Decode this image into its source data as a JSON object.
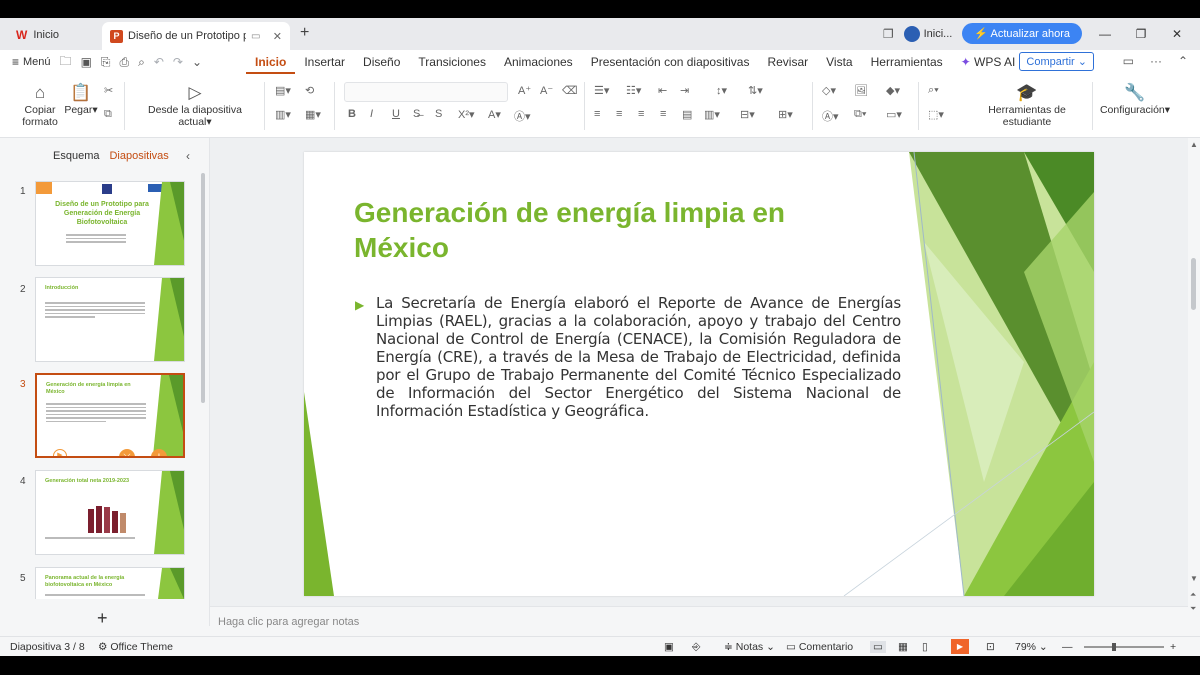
{
  "window": {
    "home_tab": "Inicio",
    "doc_tab": "Diseño de un Prototipo para G",
    "user": "Inici...",
    "upgrade": "Actualizar ahora"
  },
  "menu": {
    "menu_label": "Menú",
    "tabs": [
      "Inicio",
      "Insertar",
      "Diseño",
      "Transiciones",
      "Animaciones",
      "Presentación con diapositivas",
      "Revisar",
      "Vista",
      "Herramientas"
    ],
    "wps_ai": "WPS AI",
    "share": "Compartir"
  },
  "ribbon": {
    "copy_format": "Copiar formato",
    "paste": "Pegar",
    "from_current": "Desde la diapositiva actual",
    "student_tools": "Herramientas de estudiante",
    "settings": "Configuración"
  },
  "left_panel": {
    "tab_outline": "Esquema",
    "tab_slides": "Diapositivas",
    "thumbs": [
      {
        "num": "1",
        "title": "Diseño de un Prototipo para Generación de Energía Biofotovoltaica"
      },
      {
        "num": "2",
        "title": "Introducción"
      },
      {
        "num": "3",
        "title": "Generación de energía limpia en México"
      },
      {
        "num": "4",
        "title": "Generación total neta 2019-2023"
      },
      {
        "num": "5",
        "title": "Panorama actual de la energía biofotovoltaica en México"
      }
    ]
  },
  "slide": {
    "title": "Generación de energía limpia en México",
    "body": "La Secretaría de Energía elaboró el Reporte de Avance de Energías Limpias (RAEL), gracias a la colaboración, apoyo y trabajo del Centro Nacional de Control de Energía (CENACE), la Comisión Reguladora de Energía (CRE), a través de la Mesa de Trabajo de Electricidad, definida por el Grupo de Trabajo Permanente del Comité Técnico Especializado de Información del Sector Energético del Sistema Nacional de Información Estadística y Geográfica."
  },
  "notes_placeholder": "Haga clic para agregar notas",
  "status": {
    "slide_counter": "Diapositiva 3 / 8",
    "theme": "Office Theme",
    "notes": "Notas",
    "comment": "Comentario",
    "zoom": "79%"
  },
  "colors": {
    "accent": "#c44d12",
    "slide_green": "#7ab52e",
    "upgrade_blue": "#3c84f3"
  }
}
